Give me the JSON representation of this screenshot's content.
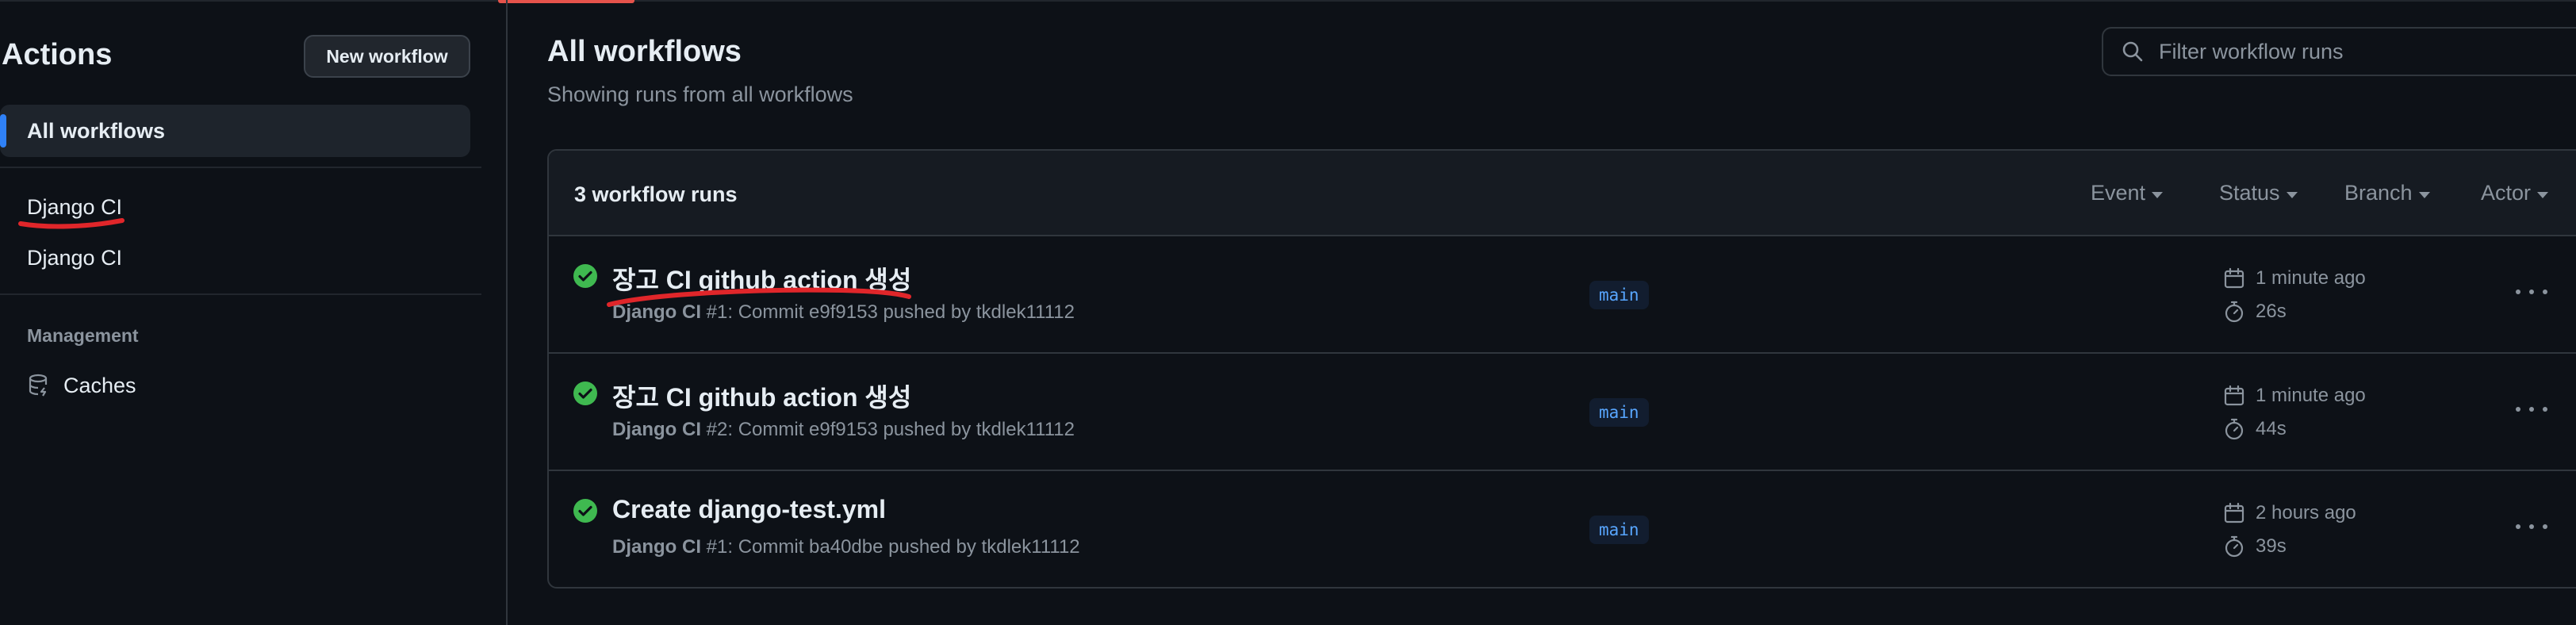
{
  "sidebar": {
    "title": "Actions",
    "new_workflow_label": "New workflow",
    "all_workflows_label": "All workflows",
    "workflows": [
      {
        "label": "Django CI"
      },
      {
        "label": "Django CI"
      }
    ],
    "management_heading": "Management",
    "caches_label": "Caches"
  },
  "main": {
    "title": "All workflows",
    "subtitle": "Showing runs from all workflows",
    "filter_placeholder": "Filter workflow runs"
  },
  "runs": {
    "count_label": "3 workflow runs",
    "filters": [
      {
        "label": "Event"
      },
      {
        "label": "Status"
      },
      {
        "label": "Branch"
      },
      {
        "label": "Actor"
      }
    ],
    "items": [
      {
        "title": "장고 CI github action 생성",
        "workflow": "Django CI",
        "meta": " #1: Commit e9f9153 pushed by tkdlek11112",
        "branch": "main",
        "time_ago": "1 minute ago",
        "duration": "26s",
        "status": "success"
      },
      {
        "title": "장고 CI github action 생성",
        "workflow": "Django CI",
        "meta": " #2: Commit e9f9153 pushed by tkdlek11112",
        "branch": "main",
        "time_ago": "1 minute ago",
        "duration": "44s",
        "status": "success"
      },
      {
        "title": "Create django-test.yml",
        "workflow": "Django CI",
        "meta": " #1: Commit ba40dbe pushed by tkdlek11112",
        "branch": "main",
        "time_ago": "2 hours ago",
        "duration": "39s",
        "status": "success"
      }
    ]
  },
  "colors": {
    "background": "#0d1117",
    "success": "#3fb950",
    "accent_blue": "#2f81f7",
    "annotation_red": "#e0262a"
  },
  "icons": [
    "search-icon",
    "database-icon",
    "check-circle-icon",
    "calendar-icon",
    "stopwatch-icon",
    "kebab-icon",
    "caret-down-icon"
  ]
}
